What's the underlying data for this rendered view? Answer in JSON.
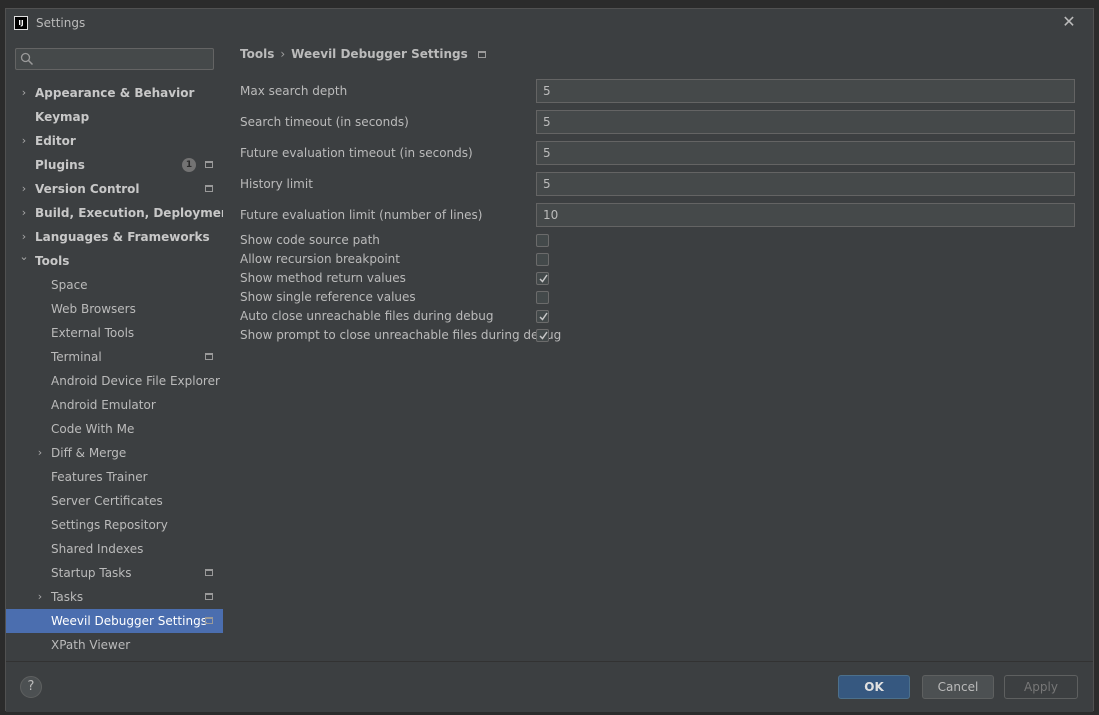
{
  "window": {
    "title": "Settings",
    "app_icon_label": "IJ"
  },
  "search": {
    "placeholder": "",
    "value": ""
  },
  "sidebar": {
    "items": [
      {
        "label": "Appearance & Behavior",
        "level": 0,
        "bold": true,
        "expandable": true,
        "expanded": false
      },
      {
        "label": "Keymap",
        "level": 0,
        "bold": true
      },
      {
        "label": "Editor",
        "level": 0,
        "bold": true,
        "expandable": true,
        "expanded": false
      },
      {
        "label": "Plugins",
        "level": 0,
        "bold": true,
        "badge": "1",
        "project": true
      },
      {
        "label": "Version Control",
        "level": 0,
        "bold": true,
        "expandable": true,
        "expanded": false,
        "project": true
      },
      {
        "label": "Build, Execution, Deployment",
        "level": 0,
        "bold": true,
        "expandable": true,
        "expanded": false
      },
      {
        "label": "Languages & Frameworks",
        "level": 0,
        "bold": true,
        "expandable": true,
        "expanded": false
      },
      {
        "label": "Tools",
        "level": 0,
        "bold": true,
        "expandable": true,
        "expanded": true
      },
      {
        "label": "Space",
        "level": 1
      },
      {
        "label": "Web Browsers",
        "level": 1
      },
      {
        "label": "External Tools",
        "level": 1
      },
      {
        "label": "Terminal",
        "level": 1,
        "project": true
      },
      {
        "label": "Android Device File Explorer",
        "level": 1
      },
      {
        "label": "Android Emulator",
        "level": 1
      },
      {
        "label": "Code With Me",
        "level": 1
      },
      {
        "label": "Diff & Merge",
        "level": 1,
        "expandable": true,
        "expanded": false
      },
      {
        "label": "Features Trainer",
        "level": 1
      },
      {
        "label": "Server Certificates",
        "level": 1
      },
      {
        "label": "Settings Repository",
        "level": 1
      },
      {
        "label": "Shared Indexes",
        "level": 1
      },
      {
        "label": "Startup Tasks",
        "level": 1,
        "project": true
      },
      {
        "label": "Tasks",
        "level": 1,
        "expandable": true,
        "expanded": false,
        "project": true
      },
      {
        "label": "Weevil Debugger Settings",
        "level": 1,
        "project": true,
        "selected": true
      },
      {
        "label": "XPath Viewer",
        "level": 1
      }
    ]
  },
  "breadcrumb": {
    "parent": "Tools",
    "separator": "›",
    "current": "Weevil Debugger Settings"
  },
  "fields": [
    {
      "label": "Max search depth",
      "value": "5"
    },
    {
      "label": "Search timeout (in seconds)",
      "value": "5"
    },
    {
      "label": "Future evaluation timeout (in seconds)",
      "value": "5"
    },
    {
      "label": "History limit",
      "value": "5"
    },
    {
      "label": "Future evaluation limit (number of lines)",
      "value": "10"
    }
  ],
  "checkboxes": [
    {
      "label": "Show code source path",
      "checked": false
    },
    {
      "label": "Allow recursion breakpoint",
      "checked": false
    },
    {
      "label": "Show method return values",
      "checked": true
    },
    {
      "label": "Show single reference values",
      "checked": false
    },
    {
      "label": "Auto close unreachable files during debug",
      "checked": true
    },
    {
      "label": "Show prompt to close unreachable files during debug",
      "checked": true
    }
  ],
  "footer": {
    "help": "?",
    "ok": "OK",
    "cancel": "Cancel",
    "apply": "Apply"
  },
  "colors": {
    "accent": "#4b6eaf",
    "default_button": "#365880",
    "background": "#3c3f41"
  }
}
